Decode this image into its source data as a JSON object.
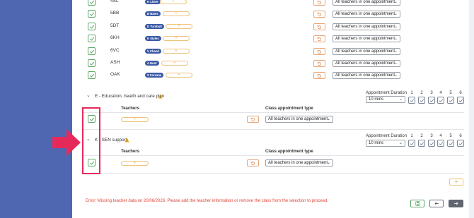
{
  "class_rows": [
    {
      "name": "4SL",
      "teacher": "K Lister",
      "appointment": "All teachers in one appointment"
    },
    {
      "name": "5BB",
      "teacher": "B Bates",
      "appointment": "All teachers in one appointment"
    },
    {
      "name": "5DT",
      "teacher": "D Turnbull",
      "appointment": "All teachers in one appointment"
    },
    {
      "name": "6KH",
      "teacher": "K Styles",
      "appointment": "All teachers in one appointment"
    },
    {
      "name": "6VC",
      "teacher": "V Chand",
      "appointment": "All teachers in one appointment"
    },
    {
      "name": "ASH",
      "teacher": "A Hunt",
      "appointment": "All teachers in one appointment"
    },
    {
      "name": "OAK",
      "teacher": "S Forsane",
      "appointment": "All teachers in one appointment"
    }
  ],
  "pill_symbol": "+",
  "sections": [
    {
      "title": "E - Education, health and care plan",
      "duration_label": "Appointment Duration",
      "duration_value": "10 mins",
      "slots": [
        "1",
        "2",
        "3",
        "4",
        "5",
        "6"
      ],
      "teachers_header": "Teachers",
      "appt_type_header": "Class appointment type",
      "appointment": "All teachers in one appointment"
    },
    {
      "title": "K - SEN support",
      "duration_label": "Appointment Duration",
      "duration_value": "10 mins",
      "slots": [
        "1",
        "2",
        "3",
        "4",
        "5",
        "6"
      ],
      "teachers_header": "Teachers",
      "appt_type_header": "Class appointment type",
      "appointment": "All teachers in one appointment"
    }
  ],
  "error_message": "Error: Missing teacher data on 20/06/2026. Please add the teacher information or remove the class from the selection to proceed.",
  "add_symbol": "+",
  "colors": {
    "sidebar": "#4f67b0",
    "accent_green": "#5fa86a",
    "highlight": "#e52a5b",
    "warning": "#f2b01e",
    "error": "#e0453a"
  }
}
